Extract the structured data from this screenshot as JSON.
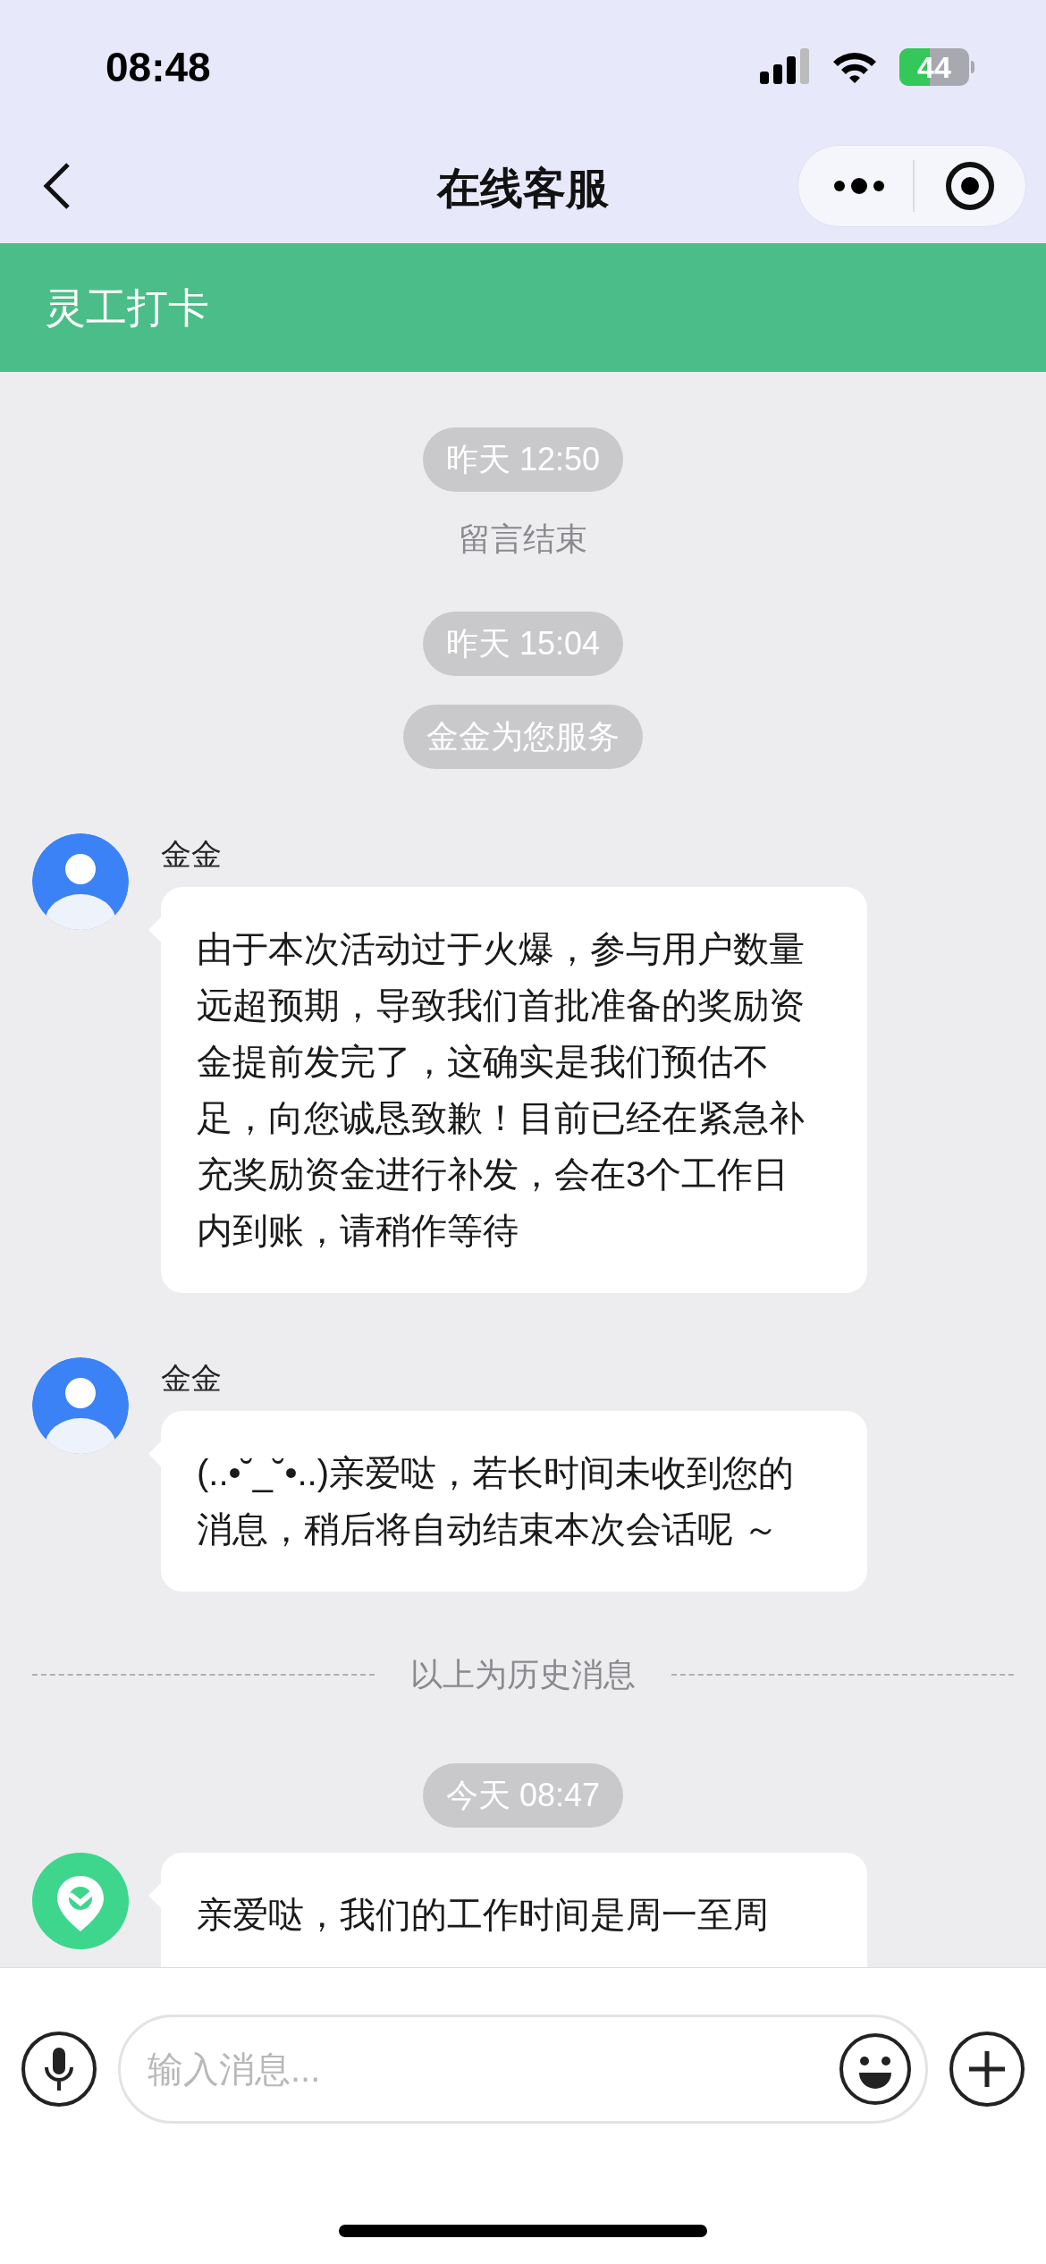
{
  "status_bar": {
    "time": "08:48",
    "battery": "44"
  },
  "nav": {
    "title": "在线客服"
  },
  "banner": {
    "title": "灵工打卡"
  },
  "chat": [
    {
      "kind": "time",
      "text": "昨天 12:50"
    },
    {
      "kind": "notice",
      "text": "留言结束"
    },
    {
      "kind": "time",
      "text": "昨天 15:04"
    },
    {
      "kind": "time",
      "text": "金金为您服务"
    },
    {
      "kind": "message",
      "avatar": {
        "kind": "person"
      },
      "sender": "金金",
      "text": "由于本次活动过于火爆，参与用户数量远超预期，导致我们首批准备的奖励资金提前发完了，这确实是我们预估不足，向您诚恳致歉！目前已经在紧急补充奖励资金进行补发，会在3个工作日内到账，请稍作等待"
    },
    {
      "kind": "message",
      "avatar": {
        "kind": "person"
      },
      "sender": "金金",
      "text": "(..•˘_˘•..)亲爱哒，若长时间未收到您的消息，稍后将自动结束本次会话呢 ～"
    },
    {
      "kind": "divider",
      "text": "以上为历史消息"
    },
    {
      "kind": "time",
      "text": "今天 08:47"
    },
    {
      "kind": "message",
      "avatar": {
        "kind": "logo"
      },
      "text": "亲爱哒，我们的工作时间是周一至周"
    }
  ],
  "input": {
    "placeholder": "输入消息..."
  }
}
